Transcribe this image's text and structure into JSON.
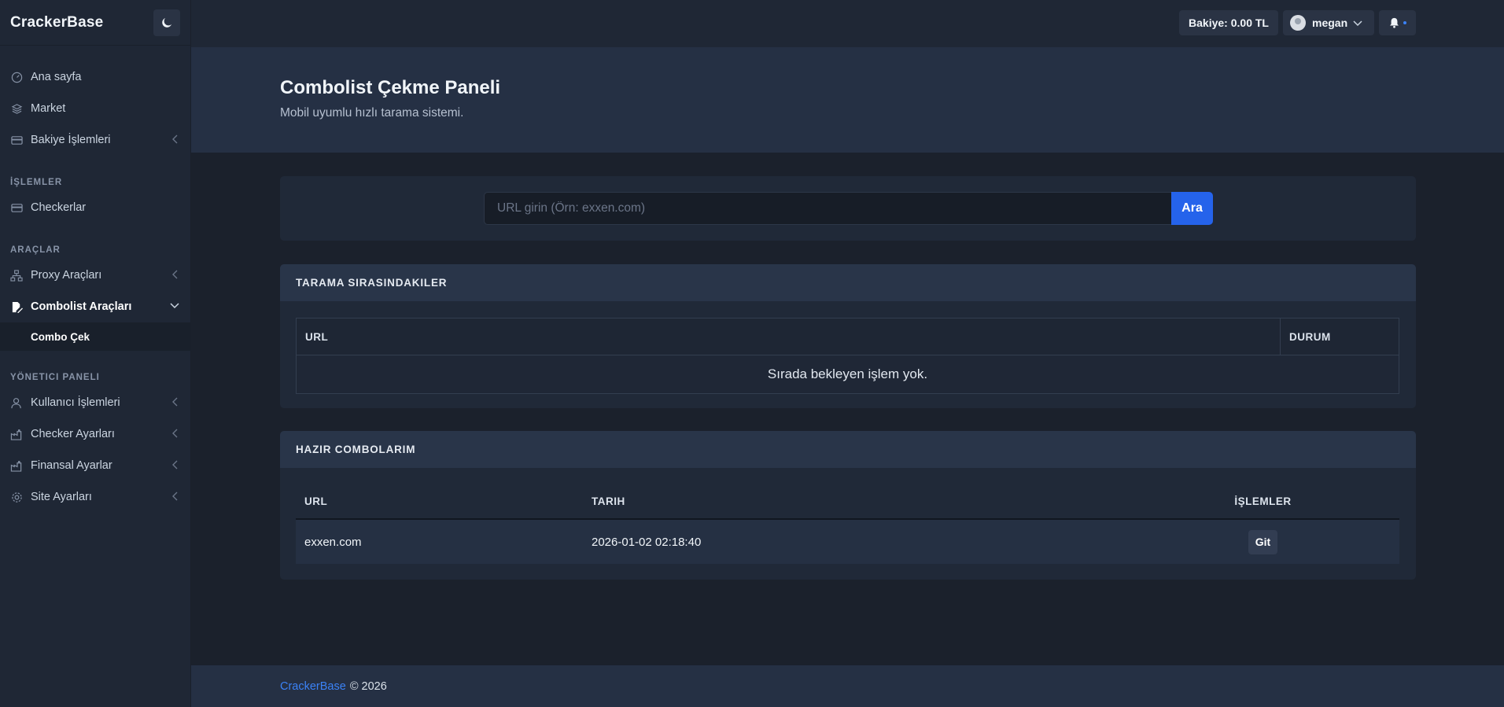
{
  "brand": "CrackerBase",
  "sidebar": {
    "items_top": [
      {
        "label": "Ana sayfa",
        "icon": "gauge-icon"
      },
      {
        "label": "Market",
        "icon": "layers-icon"
      },
      {
        "label": "Bakiye İşlemleri",
        "icon": "credit-card-icon"
      }
    ],
    "section_islemler": "İŞLEMLER",
    "checkerlar": "Checkerlar",
    "section_araclar": "ARAÇLAR",
    "proxy": "Proxy Araçları",
    "combolist": "Combolist Araçları",
    "combo_cek": "Combo Çek",
    "section_yonetici": "YÖNETICI PANELI",
    "admin_items": [
      {
        "label": "Kullanıcı İşlemleri"
      },
      {
        "label": "Checker Ayarları"
      },
      {
        "label": "Finansal Ayarlar"
      },
      {
        "label": "Site Ayarları"
      }
    ]
  },
  "topbar": {
    "balance": "Bakiye: 0.00 TL",
    "username": "megan"
  },
  "hero": {
    "title": "Combolist Çekme Paneli",
    "subtitle": "Mobil uyumlu hızlı tarama sistemi."
  },
  "search": {
    "placeholder": "URL girin (Örn: exxen.com)",
    "button": "Ara"
  },
  "queue": {
    "title": "TARAMA SIRASINDAKILER",
    "col_url": "URL",
    "col_status": "DURUM",
    "empty": "Sırada bekleyen işlem yok."
  },
  "ready": {
    "title": "HAZIR COMBOLARIM",
    "col_url": "URL",
    "col_date": "TARIH",
    "col_actions": "İŞLEMLER",
    "rows": [
      {
        "url": "exxen.com",
        "date": "2026-01-02 02:18:40",
        "action": "Git"
      }
    ]
  },
  "footer": {
    "brand": "CrackerBase",
    "copy": "© 2026"
  },
  "colors": {
    "accent": "#2563eb",
    "link": "#3b82f6",
    "background": "#1b212c"
  }
}
